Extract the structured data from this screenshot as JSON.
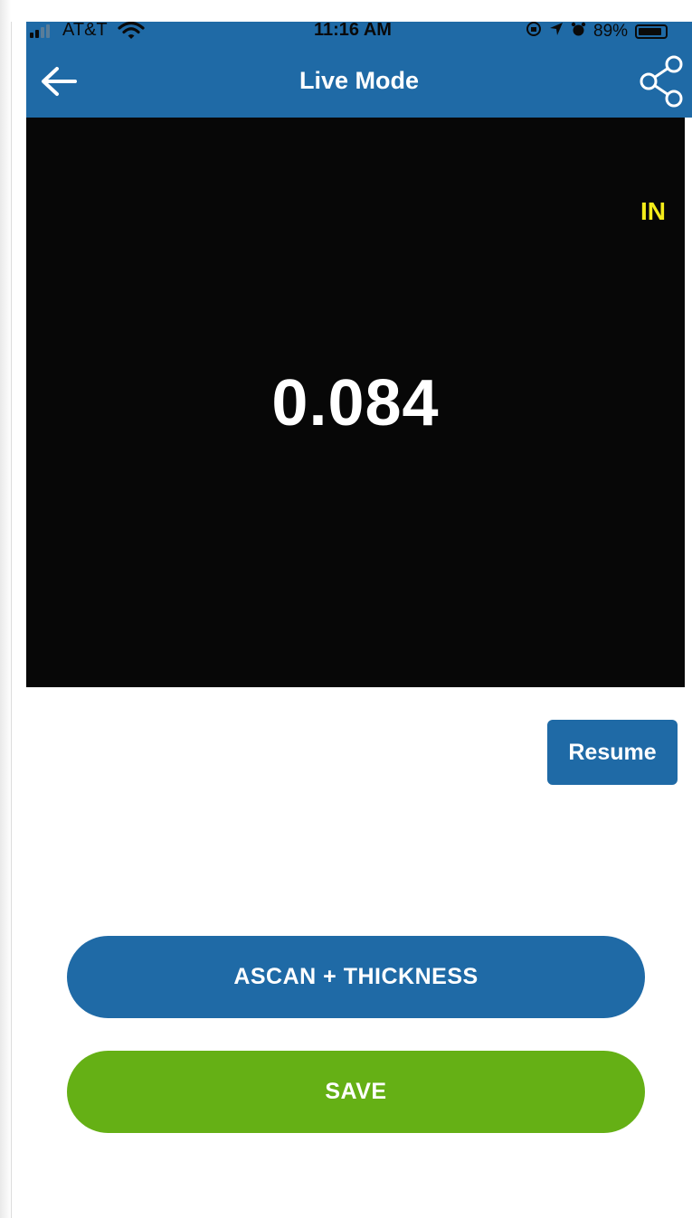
{
  "status_bar": {
    "carrier": "AT&T",
    "time": "11:16 AM",
    "battery_percent": "89%",
    "battery_level": 0.89,
    "icons": [
      "signal-icon",
      "wifi-icon",
      "rotation-lock-icon",
      "location-icon",
      "alarm-icon",
      "battery-icon"
    ]
  },
  "nav": {
    "title": "Live Mode",
    "back_icon": "arrow-left-icon",
    "share_icon": "share-icon"
  },
  "reading": {
    "unit": "IN",
    "value": "0.084"
  },
  "actions": {
    "resume_label": "Resume",
    "ascan_label": "ASCAN + THICKNESS",
    "save_label": "SAVE"
  },
  "colors": {
    "primary": "#1f6aa6",
    "save": "#65b015",
    "unit_text": "#f4ec1a",
    "panel_bg": "#070707"
  }
}
